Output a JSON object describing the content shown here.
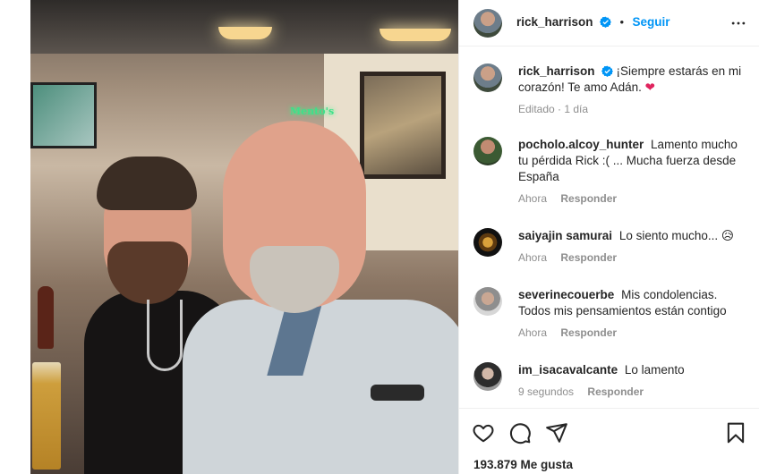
{
  "post": {
    "username": "rick_harrison",
    "follow_label": "Seguir",
    "dot": "•"
  },
  "caption": {
    "username": "rick_harrison",
    "text": "¡Siempre estarás en mi corazón! Te amo Adán.",
    "emoji": "❤",
    "time": "Editado · 1 día"
  },
  "comments": [
    {
      "username": "pocholo.alcoy_hunter",
      "text": "Lamento mucho tu pérdida Rick :( ... Mucha fuerza desde España",
      "time": "Ahora",
      "reply": "Responder"
    },
    {
      "username": "saiyajin samurai",
      "text": "Lo siento mucho... 😥",
      "time": "Ahora",
      "reply": "Responder"
    },
    {
      "username": "severinecouerbe",
      "text": "Mis condolencias. Todos mis pensamientos están contigo",
      "time": "Ahora",
      "reply": "Responder"
    },
    {
      "username": "im_isacavalcante",
      "text": "Lo lamento",
      "time": "9 segundos",
      "reply": "Responder"
    }
  ],
  "photo": {
    "sign": "Mento's"
  },
  "likes": "193.879 Me gusta",
  "icons": {
    "verified": "verified-badge-icon",
    "more": "more-options-icon",
    "like": "heart-icon",
    "comment": "comment-icon",
    "share": "send-icon",
    "save": "bookmark-icon"
  },
  "colors": {
    "accent": "#0095f6",
    "text": "#262626",
    "muted": "#8e8e8e"
  }
}
